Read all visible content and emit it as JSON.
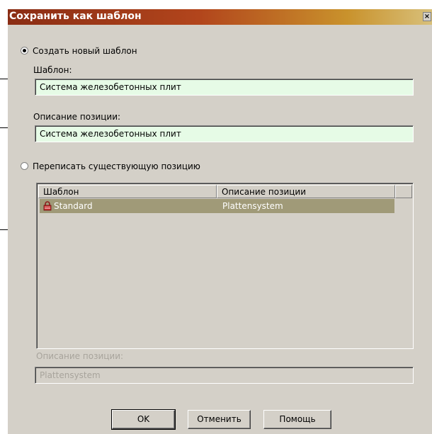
{
  "dialog": {
    "title": "Сохранить как шаблон",
    "close_symbol": "×"
  },
  "create_new": {
    "radio_label": "Создать новый шаблон",
    "selected": true,
    "template_label": "Шаблон:",
    "template_value": "Система железобетонных плит",
    "description_label": "Описание позиции:",
    "description_value": "Система железобетонных плит"
  },
  "overwrite": {
    "radio_label": "Переписать существующую позицию",
    "selected": false,
    "columns": [
      "Шаблон",
      "Описание позиции"
    ],
    "rows": [
      {
        "template": "Standard",
        "description": "Plattensystem",
        "icon": "lock-icon",
        "selected": true
      }
    ],
    "description_label": "Описание позиции:",
    "description_value": "Plattensystem"
  },
  "buttons": {
    "ok": "OK",
    "cancel": "Отменить",
    "help": "Помощь"
  },
  "colors": {
    "title_gradient_start": "#8a2d14",
    "input_green": "#e6fbe6",
    "selection": "#a09a78",
    "dialog_bg": "#d4d0c8"
  }
}
